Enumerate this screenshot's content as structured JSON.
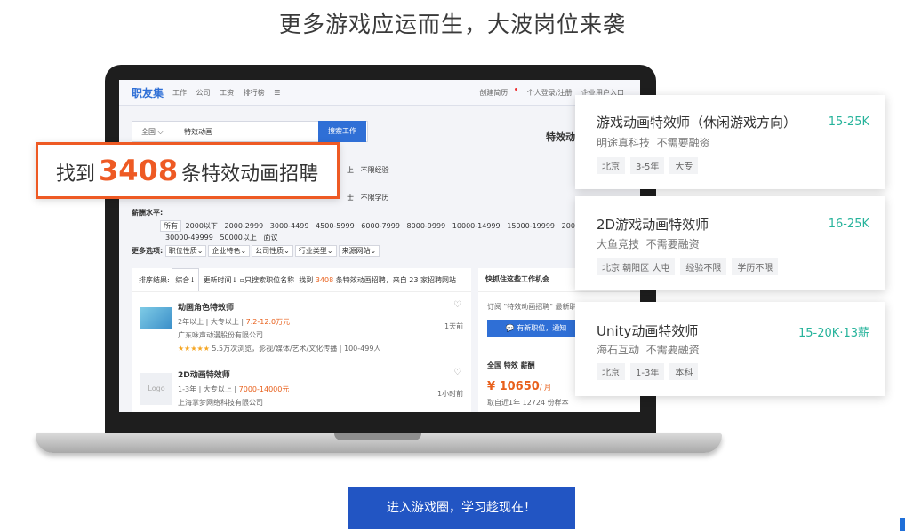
{
  "headline": "更多游戏应运而生，大波岗位来袭",
  "site": {
    "logo": "职友集",
    "nav": [
      "工作",
      "公司",
      "工资",
      "排行榜"
    ],
    "nav_menu_icon": "menu-icon",
    "right_links": [
      "创建简历",
      "个人登录/注册",
      "企业用户入口"
    ]
  },
  "search": {
    "city": "全国",
    "keyword": "特效动画",
    "button": "搜索工作"
  },
  "keyword_title": "特效动",
  "filters": {
    "exp_tail": [
      "上",
      "不限经验"
    ],
    "edu_tail": [
      "士",
      "不限学历"
    ],
    "salary_label": "薪酬水平:",
    "salary_row1": [
      "所有",
      "2000以下",
      "2000-2999",
      "3000-4499",
      "4500-5999",
      "6000-7999",
      "8000-9999",
      "10000-14999",
      "15000-19999",
      "200"
    ],
    "salary_row2": [
      "30000-49999",
      "50000以上",
      "面议"
    ],
    "more_label": "更多选项:",
    "more_options": [
      "职位性质⌄",
      "企业特色⌄",
      "公司性质⌄",
      "行业类型⌄",
      "来源网站⌄"
    ]
  },
  "results": {
    "sort_label": "排序结果:",
    "sort_default": "综合↓",
    "sort_time": "更新时间↓",
    "only_title": "只搜索职位名称",
    "found_prefix": "找到",
    "found_count": "3408",
    "found_suffix": "条特效动画招聘，来自 23 家招聘网站",
    "jobs": [
      {
        "title": "动画角色特效师",
        "meta": "2年以上 | 大专以上 | ",
        "salary": "7.2-12.0万元",
        "company": "广东咏声动漫股份有限公司",
        "stats": "5.5万次浏览，影视/媒体/艺术/文化传播 | 100-499人",
        "stars": "★★★★★",
        "time": "1天前"
      },
      {
        "title": "2D动画特效师",
        "meta": "1-3年 | 大专以上 | ",
        "salary": "7000-14000元",
        "company": "上海掌梦网络科技有限公司",
        "logo_text": "Logo",
        "time": "1小时前"
      }
    ]
  },
  "side_panel": {
    "title": "快抓住这些工作机会",
    "subscribe": "订阅 \"特效动画招聘\" 最新职",
    "wx_button": "有新职位，通知",
    "stats_title": "全国 特效 薪酬",
    "avg_salary": "¥ 10650",
    "avg_unit": "/ 月",
    "sample": "取自近1年 12724 份样本"
  },
  "overlay": {
    "prefix": "找到",
    "number": "3408",
    "suffix": "条特效动画招聘"
  },
  "cards": [
    {
      "title": "游戏动画特效师（休闲游戏方向）",
      "salary": "15-25K",
      "company": "明途真科技",
      "funding": "不需要融资",
      "tags": [
        "北京",
        "3-5年",
        "大专"
      ]
    },
    {
      "title": "2D游戏动画特效师",
      "salary": "16-25K",
      "company": "大鱼竞技",
      "funding": "不需要融资",
      "tags": [
        "北京 朝阳区 大屯",
        "经验不限",
        "学历不限"
      ]
    },
    {
      "title": "Unity动画特效师",
      "salary": "15-20K·13薪",
      "company": "海石互动",
      "funding": "不需要融资",
      "tags": [
        "北京",
        "1-3年",
        "本科"
      ]
    }
  ],
  "cta": "进入游戏圈，学习趁现在！"
}
